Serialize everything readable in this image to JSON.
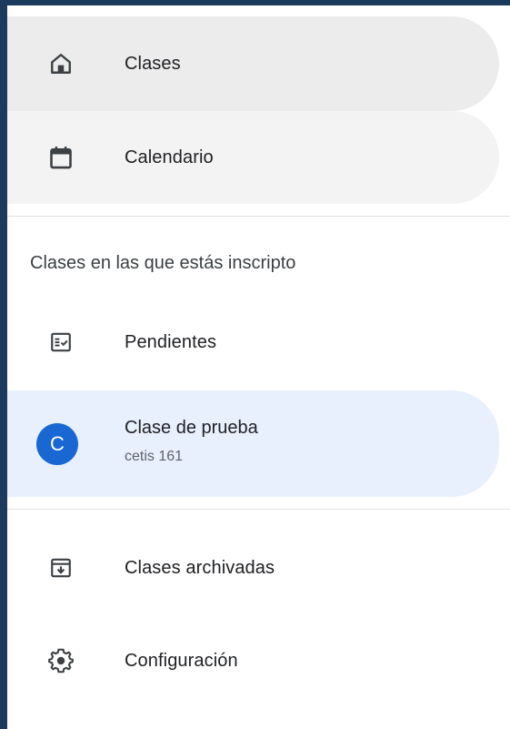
{
  "nav": {
    "clases": {
      "label": "Clases",
      "icon": "home-icon"
    },
    "calendario": {
      "label": "Calendario",
      "icon": "calendar-icon"
    }
  },
  "enrolled": {
    "title": "Clases en las que estás inscripto",
    "pendientes": {
      "label": "Pendientes",
      "icon": "assignment-check-icon"
    },
    "classes": [
      {
        "avatar_letter": "C",
        "name": "Clase de prueba",
        "section": "cetis 161",
        "avatar_color": "#1967d2"
      }
    ]
  },
  "footer_nav": {
    "archivadas": {
      "label": "Clases archivadas",
      "icon": "archive-icon"
    },
    "configuracion": {
      "label": "Configuración",
      "icon": "gear-icon"
    }
  },
  "colors": {
    "frame": "#1b3a5e",
    "active_bg": "#e8f0fe",
    "selected_bg": "#ececec"
  }
}
